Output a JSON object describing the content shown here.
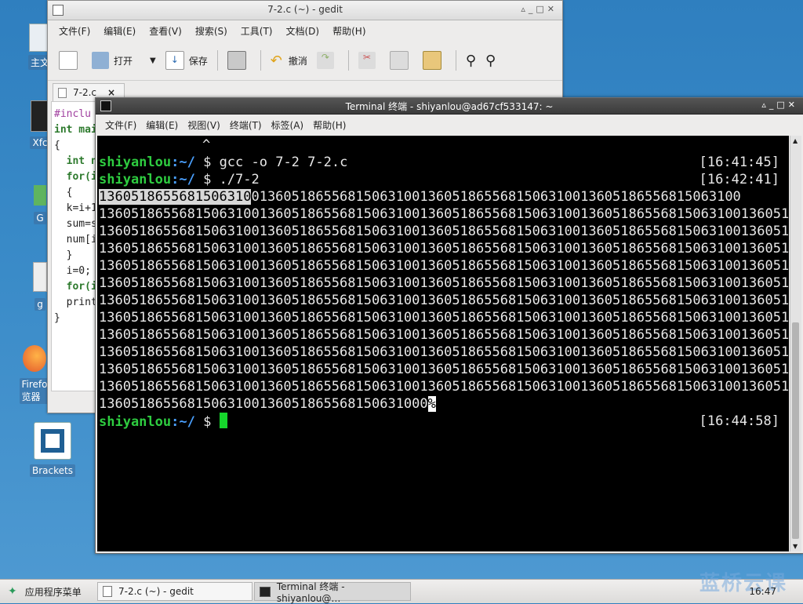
{
  "desktop": {
    "icons": [
      {
        "label": "主文"
      },
      {
        "label": "Xfc"
      },
      {
        "label": "G"
      },
      {
        "label": "g"
      },
      {
        "label": "Firefo\n览器"
      },
      {
        "label": "Brackets"
      }
    ]
  },
  "gedit": {
    "title": "7-2.c (~) - gedit",
    "menu": [
      "文件(F)",
      "编辑(E)",
      "查看(V)",
      "搜索(S)",
      "工具(T)",
      "文档(D)",
      "帮助(H)"
    ],
    "toolbar": {
      "open": "打开",
      "save": "保存",
      "undo": "撤消"
    },
    "tab_label": "7-2.c",
    "tab_close": "×",
    "code": [
      "#inclu",
      "int mai",
      "{",
      "  int n",
      "  for(i",
      "  {",
      "  k=i+1",
      "  sum=s",
      "  num[i",
      "  }",
      "  i=0;",
      "  for(i",
      "  print",
      "}"
    ]
  },
  "terminal": {
    "title": "Terminal 终端 - shiyanlou@ad67cf533147: ~",
    "menu": [
      "文件(F)",
      "编辑(E)",
      "视图(V)",
      "终端(T)",
      "标签(A)",
      "帮助(H)"
    ],
    "caret_line": "^",
    "prompt_user": "shiyanlou",
    "prompt_path": ":~/",
    "prompt_sym": " $ ",
    "cmd1": "gcc -o 7-2 7-2.c",
    "ts1": "[16:41:45]",
    "cmd2": "./7-2",
    "ts2": "[16:42:41]",
    "selected_number": "1360518655681506310",
    "first_line_rest": "0136051865568150631001360518655681506310013605186556815063100",
    "output_line": "136051865568150631001360518655681506310013605186556815063100136051865568150631001360518655681506310013605186556815063100",
    "output_line_count": 11,
    "last_output": "13605186556815063100136051865568150631000",
    "pct": "%",
    "ts3": "[16:44:58]"
  },
  "taskbar": {
    "menu": "应用程序菜单",
    "gedit_task": "7-2.c (~) - gedit",
    "term_task": "Terminal 终端 - shiyanlou@…",
    "clock": "16:47"
  },
  "watermark": "蓝桥云课"
}
